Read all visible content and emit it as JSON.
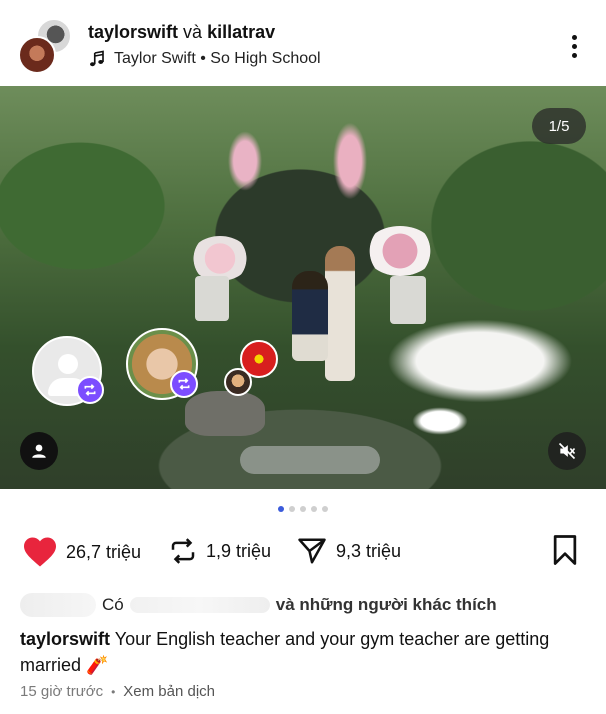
{
  "post": {
    "author_primary": "taylorswift",
    "joiner": "và",
    "author_secondary": "killatrav",
    "music": "Taylor Swift • So High School",
    "image_counter": "1/5",
    "carousel": {
      "total": 5,
      "active_index": 0
    }
  },
  "actions": {
    "likes": "26,7 triệu",
    "reposts": "1,9 triệu",
    "shares": "9,3 triệu"
  },
  "likes_line": {
    "prefix": "Có",
    "suffix": "và những người khác thích"
  },
  "caption": {
    "user": "taylorswift",
    "text": "Your English teacher and your gym teacher are getting married 🧨"
  },
  "meta": {
    "time_ago": "15 giờ trước",
    "separator": "•",
    "translate_label": "Xem bản dịch"
  },
  "colors": {
    "like_red": "#e8253d",
    "repost_badge": "#7c4dff",
    "dot_active": "#3b5bdb"
  },
  "icons": [
    "music-note-icon",
    "more-options-icon",
    "heart-icon",
    "repost-icon",
    "share-icon",
    "bookmark-icon",
    "user-icon",
    "mute-icon"
  ]
}
